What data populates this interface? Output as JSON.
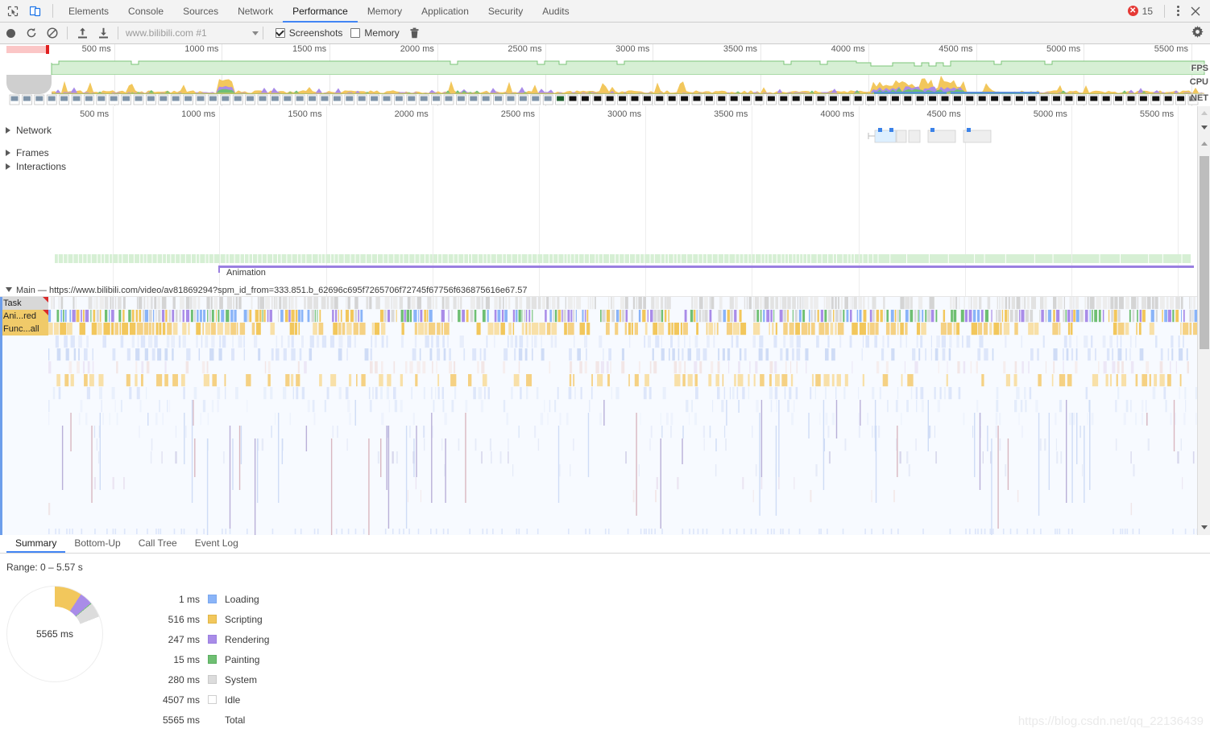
{
  "window": {
    "inspect_icon": "inspect-cursor-icon",
    "device_icon": "device-toolbar-icon",
    "error_badge_glyph": "✕",
    "error_count": "15",
    "menu_icon": "kebab-menu-icon",
    "close_icon": "✕"
  },
  "tabs": [
    {
      "label": "Elements",
      "active": false
    },
    {
      "label": "Console",
      "active": false
    },
    {
      "label": "Sources",
      "active": false
    },
    {
      "label": "Network",
      "active": false
    },
    {
      "label": "Performance",
      "active": true
    },
    {
      "label": "Memory",
      "active": false
    },
    {
      "label": "Application",
      "active": false
    },
    {
      "label": "Security",
      "active": false
    },
    {
      "label": "Audits",
      "active": false
    }
  ],
  "toolbar": {
    "record_icon": "record-circle-icon",
    "reload_record_icon": "reload-record-icon",
    "clear_icon": "clear-recording-icon",
    "load_icon": "load-profile-icon",
    "save_icon": "save-profile-icon",
    "url_value": "www.bilibili.com #1",
    "url_dropdown_icon": "chevron-down-icon",
    "screenshots_label": "Screenshots",
    "screenshots_checked": true,
    "memory_label": "Memory",
    "memory_checked": false,
    "trash_icon": "trash-icon",
    "settings_icon": "gear-icon"
  },
  "overview": {
    "ticks": [
      "500 ms",
      "1000 ms",
      "1500 ms",
      "2000 ms",
      "2500 ms",
      "3000 ms",
      "3500 ms",
      "4000 ms",
      "4500 ms",
      "5000 ms",
      "5500 ms"
    ],
    "row_labels": [
      "FPS",
      "CPU",
      "NET"
    ]
  },
  "timeline": {
    "ticks": [
      "500 ms",
      "1000 ms",
      "1500 ms",
      "2000 ms",
      "2500 ms",
      "3000 ms",
      "3500 ms",
      "4000 ms",
      "4500 ms",
      "5000 ms",
      "5500 ms"
    ],
    "groups": [
      {
        "name": "Network",
        "expanded": false
      },
      {
        "name": "Frames",
        "expanded": false
      },
      {
        "name": "Interactions",
        "expanded": false
      }
    ],
    "animation_label": "Animation",
    "main_label": "Main — https://www.bilibili.com/video/av81869294?spm_id_from=333.851.b_62696c695f7265706f72745f67756f636875616e67.57",
    "flame_rows": [
      {
        "label": "Task",
        "kind": "task",
        "warning": true
      },
      {
        "label": "Ani...red",
        "kind": "scripting",
        "warning": true
      },
      {
        "label": "Func...all",
        "kind": "scripting",
        "warning": false
      }
    ]
  },
  "bottom": {
    "tabs": [
      {
        "label": "Summary",
        "active": true
      },
      {
        "label": "Bottom-Up",
        "active": false
      },
      {
        "label": "Call Tree",
        "active": false
      },
      {
        "label": "Event Log",
        "active": false
      }
    ],
    "range_label": "Range: 0 – 5.57 s",
    "donut_center": "5565 ms"
  },
  "chart_data": {
    "type": "pie",
    "title": "Performance activity breakdown",
    "unit": "ms",
    "center_label": "5565 ms",
    "legend_position": "right",
    "categories": [
      "Loading",
      "Scripting",
      "Rendering",
      "Painting",
      "System",
      "Idle"
    ],
    "values": [
      1,
      516,
      247,
      15,
      280,
      4507
    ],
    "colors": [
      "#8ab4f8",
      "#f2c75c",
      "#a98ce8",
      "#6fbf73",
      "#dcdcdc",
      "#ffffff"
    ],
    "rows": [
      {
        "value": "1 ms",
        "name": "Loading",
        "color": "#8ab4f8",
        "border": "#7aa7ee"
      },
      {
        "value": "516 ms",
        "name": "Scripting",
        "color": "#f2c75c",
        "border": "#e0b647"
      },
      {
        "value": "247 ms",
        "name": "Rendering",
        "color": "#a98ce8",
        "border": "#9a7fe0"
      },
      {
        "value": "15 ms",
        "name": "Painting",
        "color": "#6fbf73",
        "border": "#5bae60"
      },
      {
        "value": "280 ms",
        "name": "System",
        "color": "#dcdcdc",
        "border": "#c9c9c9"
      },
      {
        "value": "4507 ms",
        "name": "Idle",
        "color": "#ffffff",
        "border": "#cfcfcf"
      },
      {
        "value": "5565 ms",
        "name": "Total",
        "color": "transparent",
        "border": "transparent"
      }
    ],
    "total": "5565 ms"
  },
  "watermark": "https://blog.csdn.net/qq_22136439"
}
